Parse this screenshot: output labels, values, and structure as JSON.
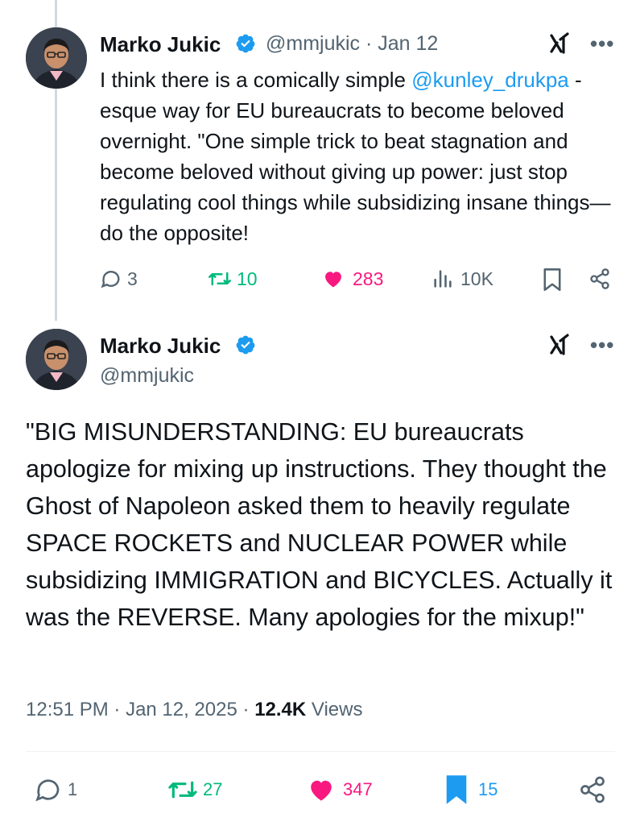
{
  "tweet1": {
    "name": "Marko Jukic",
    "handle": "@mmjukic",
    "separator": " · ",
    "date": "Jan 12",
    "text_before": "I think there is a comically simple ",
    "mention": "@kunley_drukpa",
    "text_after": " -esque way for EU bureaucrats to become beloved overnight. \"One simple trick to beat stagnation and become beloved without giving up power: just stop regulating cool things while subsidizing insane things—do the opposite!",
    "actions": {
      "replies": "3",
      "reposts": "10",
      "likes": "283",
      "views": "10K"
    }
  },
  "tweet2": {
    "name": "Marko Jukic",
    "handle": "@mmjukic",
    "text": "\"BIG MISUNDERSTANDING: EU bureaucrats apologize for mixing up instructions. They thought the Ghost of Napoleon asked them to heavily regulate SPACE ROCKETS and NUCLEAR POWER while subsidizing IMMIGRATION and BICYCLES. Actually it was the REVERSE. Many apologies for the mixup!\"",
    "time": "12:51 PM",
    "dot": " · ",
    "date": "Jan 12, 2025",
    "views_count": "12.4K",
    "views_label": " Views",
    "actions": {
      "replies": "1",
      "reposts": "27",
      "likes": "347",
      "bookmarks": "15"
    }
  },
  "icons": {
    "more": "more-dots-icon",
    "grok": "grok-icon",
    "verified": "verified-badge-icon"
  },
  "colors": {
    "link": "#1d9bf0",
    "secondary": "#536471",
    "repost": "#00ba7c",
    "like": "#f91880",
    "bookmark": "#1d9bf0"
  }
}
